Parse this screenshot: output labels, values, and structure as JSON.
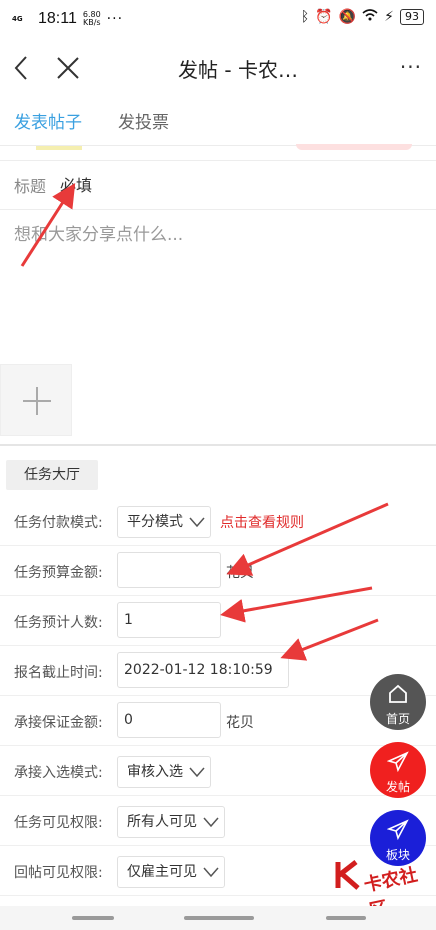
{
  "status_bar": {
    "signal": "4G",
    "time": "18:11",
    "speed_value": "6.80",
    "speed_unit": "KB/s",
    "dots": "···",
    "battery": "93"
  },
  "nav": {
    "title": "发帖 - 卡农…",
    "more": "···"
  },
  "tabs": {
    "post": "发表帖子",
    "vote": "发投票"
  },
  "form": {
    "title_label": "标题",
    "title_placeholder": "必填",
    "content_placeholder": "想和大家分享点什么...",
    "task_hall": "任务大厅",
    "payment_mode_label": "任务付款模式:",
    "payment_mode_value": "平分模式",
    "rules_link": "点击查看规则",
    "budget_label": "任务预算金额:",
    "budget_value": "",
    "budget_unit": "花贝",
    "headcount_label": "任务预计人数:",
    "headcount_value": "1",
    "deadline_label": "报名截止时间:",
    "deadline_value": "2022-01-12 18:10:59",
    "deposit_label": "承接保证金额:",
    "deposit_value": "0",
    "deposit_unit": "花贝",
    "select_mode_label": "承接入选模式:",
    "select_mode_value": "审核入选",
    "visibility_label": "任务可见权限:",
    "visibility_value": "所有人可见",
    "reply_visibility_label": "回帖可见权限:",
    "reply_visibility_value": "仅雇主可见"
  },
  "fabs": {
    "home": "首页",
    "post": "发帖",
    "board": "板块"
  },
  "watermark": "卡农社区",
  "colors": {
    "accent": "#3aa0e0",
    "link_red": "#e02b2b",
    "fab_home": "#555555",
    "fab_post": "#f0201f",
    "fab_board": "#1b1fd8",
    "annotation_arrow": "#e83a3a"
  }
}
